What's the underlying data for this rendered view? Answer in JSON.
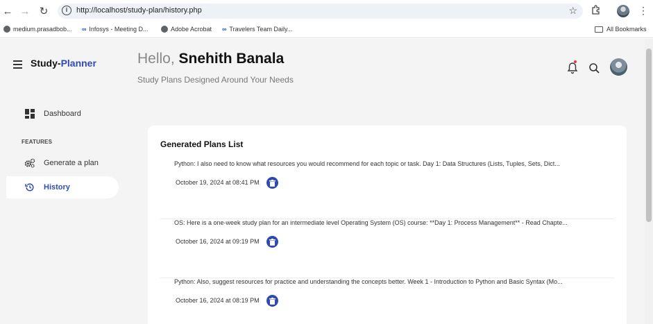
{
  "browser": {
    "url": "http://localhost/study-plan/history.php",
    "bookmarks": [
      {
        "label": "medium.prasadbob..."
      },
      {
        "label": "Infosys - Meeting D..."
      },
      {
        "label": "Adobe Acrobat"
      },
      {
        "label": "Travelers Team Daily..."
      }
    ],
    "all_bookmarks": "All Bookmarks"
  },
  "brand": {
    "part1": "Study-",
    "part2": "Planner"
  },
  "header": {
    "greeting_prefix": "Hello,",
    "user_name": "Snehith Banala",
    "subtitle": "Study Plans Designed Around Your Needs"
  },
  "sidebar": {
    "dashboard": "Dashboard",
    "features_heading": "FEATURES",
    "generate": "Generate a plan",
    "history": "History"
  },
  "plans": {
    "title": "Generated Plans List",
    "items": [
      {
        "text": "Python: I also need to know what resources you would recommend for each topic or task. Day 1: Data Structures (Lists, Tuples, Sets, Dict...",
        "date": "October 19, 2024 at 08:41 PM"
      },
      {
        "text": "OS: Here is a one-week study plan for an intermediate level Operating System (OS) course: **Day 1: Process Management** - Read Chapte...",
        "date": "October 16, 2024 at 09:19 PM"
      },
      {
        "text": "Python: Also, suggest resources for practice and understanding the concepts better. Week 1 - Introduction to Python and Basic Syntax (Mo...",
        "date": "October 16, 2024 at 08:19 PM"
      }
    ]
  },
  "colors": {
    "accent": "#2f4bb3",
    "background": "#f4f4f4",
    "notification": "#e53935"
  },
  "icons": [
    "back-icon",
    "forward-icon",
    "reload-icon",
    "info-icon",
    "star-icon",
    "extensions-icon",
    "menu-icon",
    "bell-icon",
    "search-icon",
    "dashboard-icon",
    "gears-icon",
    "history-icon",
    "trash-icon",
    "folder-icon"
  ]
}
